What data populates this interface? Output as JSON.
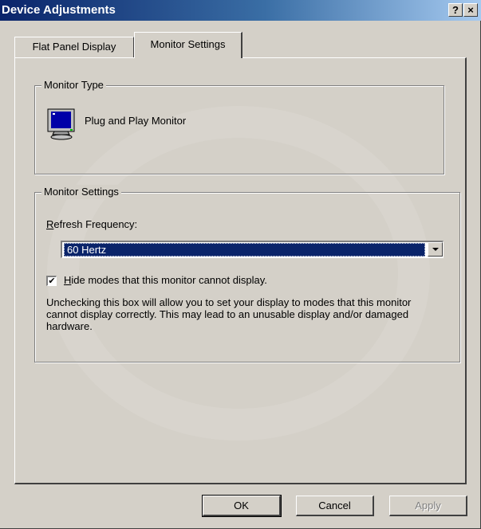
{
  "window": {
    "title": "Device Adjustments",
    "help_glyph": "?",
    "close_glyph": "×"
  },
  "tabs": [
    {
      "label": "Flat Panel Display",
      "active": false
    },
    {
      "label": "Monitor Settings",
      "active": true
    }
  ],
  "monitor_type": {
    "group_label": "Monitor Type",
    "icon": "monitor-icon",
    "name": "Plug and Play Monitor"
  },
  "monitor_settings": {
    "group_label": "Monitor Settings",
    "refresh_label_mnemonic": "R",
    "refresh_label_rest": "efresh Frequency:",
    "refresh_value": "60 Hertz",
    "hide_modes_checked": true,
    "hide_modes_mnemonic": "H",
    "hide_modes_rest": "ide modes that this monitor cannot display.",
    "warning_text": "Unchecking this box will allow you to set your display to modes that this monitor cannot display correctly. This may lead to an unusable display and/or damaged hardware."
  },
  "buttons": {
    "ok": "OK",
    "cancel": "Cancel",
    "apply": "Apply"
  },
  "colors": {
    "title_start": "#0a246a",
    "title_end": "#a6caf0",
    "face": "#d4d0c8",
    "selection": "#0a246a"
  }
}
